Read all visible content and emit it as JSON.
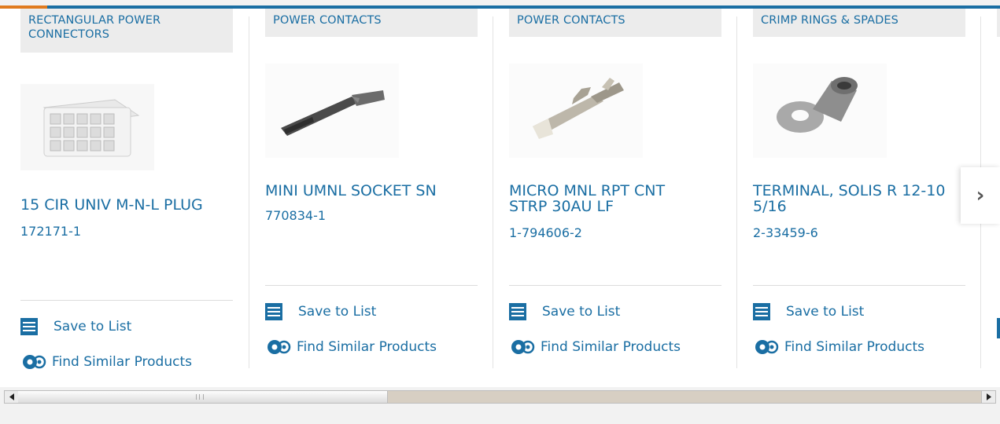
{
  "cards": [
    {
      "category": "RECTANGULAR POWER CONNECTORS",
      "title": "15 CIR UNIV M-N-L PLUG",
      "part_number": "172171-1",
      "save_label": "Save to List",
      "similar_label": "Find Similar Products",
      "image_icon": "connector-plug-image"
    },
    {
      "category": "POWER CONTACTS",
      "title": "MINI UMNL SOCKET SN",
      "part_number": "770834-1",
      "save_label": "Save to List",
      "similar_label": "Find Similar Products",
      "image_icon": "socket-contact-image"
    },
    {
      "category": "POWER CONTACTS",
      "title": "MICRO MNL RPT CNT STRP 30AU LF",
      "part_number": "1-794606-2",
      "save_label": "Save to List",
      "similar_label": "Find Similar Products",
      "image_icon": "crimp-contact-image"
    },
    {
      "category": "CRIMP RINGS & SPADES",
      "title": "TERMINAL, SOLIS R 12-10 5/16",
      "part_number": "2-33459-6",
      "save_label": "Save to List",
      "similar_label": "Find Similar Products",
      "image_icon": "ring-terminal-image"
    }
  ],
  "carousel": {
    "next_icon": "chevron-right-icon",
    "next_glyph": "›"
  },
  "colors": {
    "link": "#1a6ea3",
    "accent": "#e07b1f",
    "category_bg": "#ececec"
  }
}
